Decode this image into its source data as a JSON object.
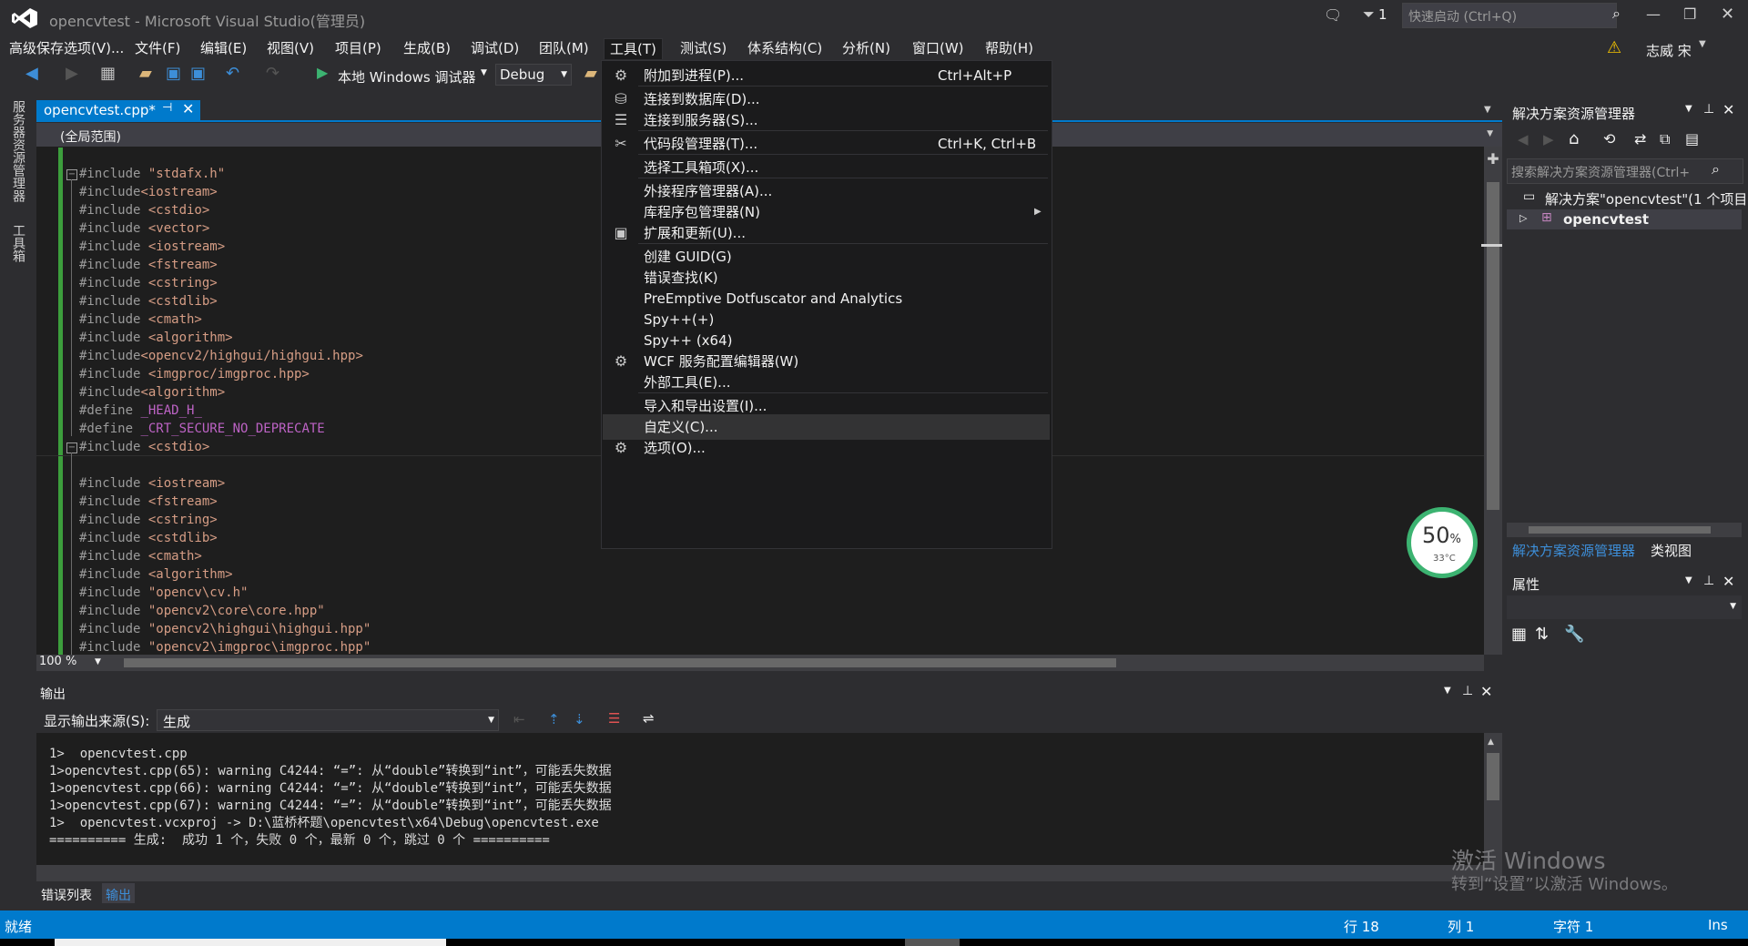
{
  "window": {
    "title": "opencvtest - Microsoft Visual Studio(管理员)",
    "filter_count": "1",
    "quick_launch_placeholder": "快速启动 (Ctrl+Q)",
    "user": "志威 宋"
  },
  "menubar": [
    "高级保存选项(V)...",
    "文件(F)",
    "编辑(E)",
    "视图(V)",
    "项目(P)",
    "生成(B)",
    "调试(D)",
    "团队(M)",
    "工具(T)",
    "测试(S)",
    "体系结构(C)",
    "分析(N)",
    "窗口(W)",
    "帮助(H)"
  ],
  "toolbar": {
    "run_label": "本地 Windows 调试器",
    "config": "Debug"
  },
  "left_strip": {
    "server_explorer": "服务器资源管理器",
    "toolbox": "工具箱"
  },
  "editor": {
    "tab_label": "opencvtest.cpp*",
    "scope": "(全局范围)",
    "zoom": "100 %",
    "lines": [
      {
        "pre": "#include ",
        "inc": "\"stdafx.h\""
      },
      {
        "pre": "#include",
        "inc": "<iostream>"
      },
      {
        "pre": "#include ",
        "inc": "<cstdio>"
      },
      {
        "pre": "#include ",
        "inc": "<vector>"
      },
      {
        "pre": "#include ",
        "inc": "<iostream>"
      },
      {
        "pre": "#include ",
        "inc": "<fstream>"
      },
      {
        "pre": "#include ",
        "inc": "<cstring>"
      },
      {
        "pre": "#include ",
        "inc": "<cstdlib>"
      },
      {
        "pre": "#include ",
        "inc": "<cmath>"
      },
      {
        "pre": "#include ",
        "inc": "<algorithm>"
      },
      {
        "pre": "#include",
        "inc": "<opencv2/highgui/highgui.hpp>"
      },
      {
        "pre": "#include ",
        "inc": "<imgproc/imgproc.hpp>"
      },
      {
        "pre": "#include",
        "inc": "<algorithm>"
      },
      {
        "pre": "#define ",
        "macro": "_HEAD_H_"
      },
      {
        "pre": "#define ",
        "macro": "_CRT_SECURE_NO_DEPRECATE"
      },
      {
        "pre": "#include ",
        "inc": "<cstdio>"
      },
      {
        "pre": "",
        "inc": ""
      },
      {
        "pre": "#include ",
        "inc": "<iostream>"
      },
      {
        "pre": "#include ",
        "inc": "<fstream>"
      },
      {
        "pre": "#include ",
        "inc": "<cstring>"
      },
      {
        "pre": "#include ",
        "inc": "<cstdlib>"
      },
      {
        "pre": "#include ",
        "inc": "<cmath>"
      },
      {
        "pre": "#include ",
        "inc": "<algorithm>"
      },
      {
        "pre": "#include ",
        "inc": "\"opencv\\cv.h\""
      },
      {
        "pre": "#include ",
        "inc": "\"opencv2\\core\\core.hpp\""
      },
      {
        "pre": "#include ",
        "inc": "\"opencv2\\highgui\\highgui.hpp\""
      },
      {
        "pre": "#include ",
        "inc": "\"opencv2\\imgproc\\imgproc.hpp\""
      }
    ]
  },
  "tools_menu": [
    {
      "label": "附加到进程(P)...",
      "shortcut": "Ctrl+Alt+P",
      "icon": "attach-icon"
    },
    {
      "label": "连接到数据库(D)...",
      "shortcut": "",
      "icon": "database-icon"
    },
    {
      "label": "连接到服务器(S)...",
      "shortcut": "",
      "icon": "server-icon"
    },
    {
      "label": "代码段管理器(T)...",
      "shortcut": "Ctrl+K, Ctrl+B",
      "icon": "snippet-icon"
    },
    {
      "label": "选择工具箱项(X)...",
      "shortcut": "",
      "icon": ""
    },
    {
      "label": "外接程序管理器(A)...",
      "shortcut": "",
      "icon": ""
    },
    {
      "label": "库程序包管理器(N)",
      "shortcut": "",
      "icon": ""
    },
    {
      "label": "扩展和更新(U)...",
      "shortcut": "",
      "icon": "extensions-icon"
    },
    {
      "label": "创建 GUID(G)",
      "shortcut": "",
      "icon": ""
    },
    {
      "label": "错误查找(K)",
      "shortcut": "",
      "icon": ""
    },
    {
      "label": "PreEmptive Dotfuscator and Analytics",
      "shortcut": "",
      "icon": ""
    },
    {
      "label": "Spy++(+)",
      "shortcut": "",
      "icon": ""
    },
    {
      "label": "Spy++ (x64)",
      "shortcut": "",
      "icon": ""
    },
    {
      "label": "WCF 服务配置编辑器(W)",
      "shortcut": "",
      "icon": "wcf-icon"
    },
    {
      "label": "外部工具(E)...",
      "shortcut": "",
      "icon": ""
    },
    {
      "label": "导入和导出设置(I)...",
      "shortcut": "",
      "icon": ""
    },
    {
      "label": "自定义(C)...",
      "shortcut": "",
      "icon": ""
    },
    {
      "label": "选项(O)...",
      "shortcut": "",
      "icon": "gear-icon"
    }
  ],
  "solution_explorer": {
    "title": "解决方案资源管理器",
    "search_placeholder": "搜索解决方案资源管理器(Ctrl+",
    "solution_node": "解决方案\"opencvtest\"(1 个项目",
    "project_node": "opencvtest",
    "tab_active": "解决方案资源管理器",
    "tab_other": "类视图"
  },
  "properties": {
    "title": "属性"
  },
  "output": {
    "title": "输出",
    "source_label": "显示输出来源(S):",
    "source_value": "生成",
    "lines": [
      "1>  opencvtest.cpp",
      "1>opencvtest.cpp(65): warning C4244: “=”: 从“double”转换到“int”，可能丢失数据",
      "1>opencvtest.cpp(66): warning C4244: “=”: 从“double”转换到“int”，可能丢失数据",
      "1>opencvtest.cpp(67): warning C4244: “=”: 从“double”转换到“int”，可能丢失数据",
      "1>  opencvtest.vcxproj -> D:\\蓝桥杯题\\opencvtest\\x64\\Debug\\opencvtest.exe",
      "========== 生成:  成功 1 个，失败 0 个，最新 0 个，跳过 0 个 =========="
    ]
  },
  "bottom_tabs": {
    "errors": "错误列表",
    "output": "输出"
  },
  "status": {
    "ready": "就绪",
    "line": "行 18",
    "col": "列 1",
    "char": "字符 1",
    "mode": "Ins"
  },
  "gauge": {
    "percent": "50",
    "unit": "%",
    "temp": "33°C"
  },
  "watermark": {
    "line1": "激活 Windows",
    "line2": "转到“设置”以激活 Windows。"
  }
}
